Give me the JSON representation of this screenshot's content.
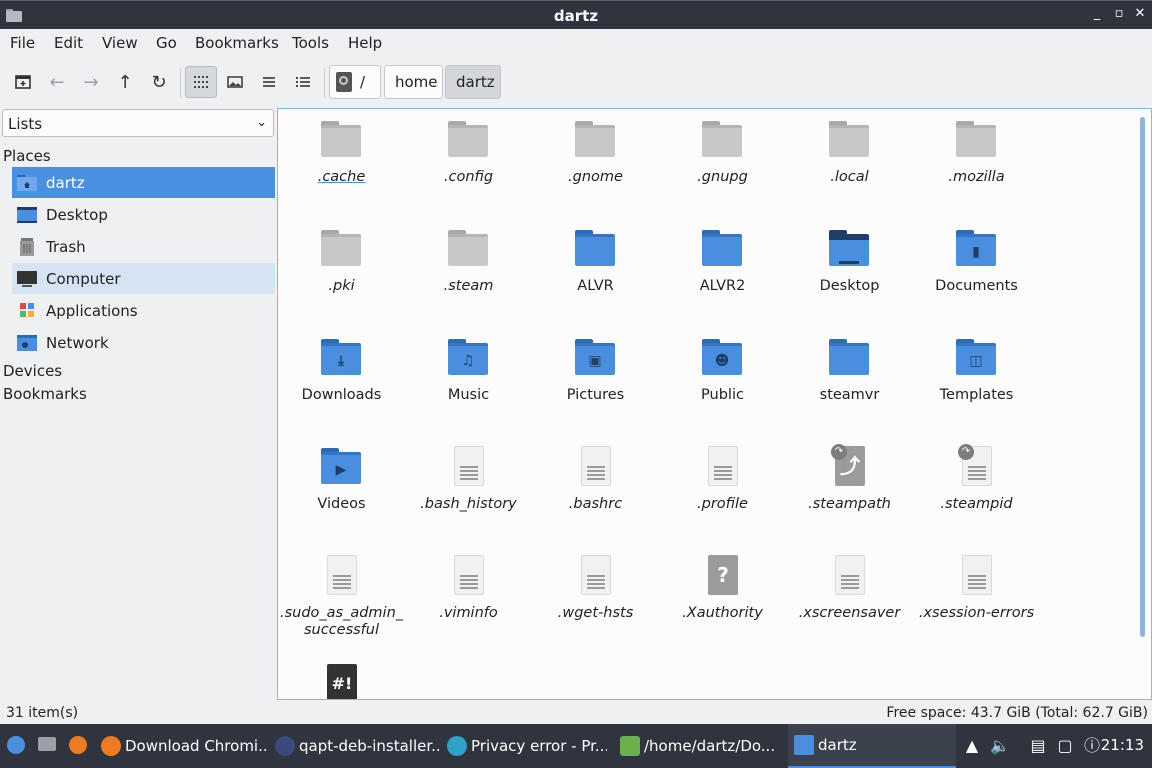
{
  "window": {
    "title": "dartz"
  },
  "menu": [
    "File",
    "Edit",
    "View",
    "Go",
    "Bookmarks",
    "Tools",
    "Help"
  ],
  "toolbar": {
    "breadcrumbs": [
      "/",
      "home",
      "dartz"
    ]
  },
  "sidebar": {
    "combo": "Lists",
    "places_heading": "Places",
    "places": [
      {
        "label": "dartz",
        "icon": "home-folder-icon"
      },
      {
        "label": "Desktop",
        "icon": "desktop-icon"
      },
      {
        "label": "Trash",
        "icon": "trash-icon"
      },
      {
        "label": "Computer",
        "icon": "computer-icon"
      },
      {
        "label": "Applications",
        "icon": "applications-icon"
      },
      {
        "label": "Network",
        "icon": "network-icon"
      }
    ],
    "devices_heading": "Devices",
    "bookmarks_heading": "Bookmarks"
  },
  "files": [
    {
      "name": ".cache",
      "kind": "folder-gray",
      "hidden": true
    },
    {
      "name": ".config",
      "kind": "folder-gray",
      "hidden": true
    },
    {
      "name": ".gnome",
      "kind": "folder-gray",
      "hidden": true
    },
    {
      "name": ".gnupg",
      "kind": "folder-gray",
      "hidden": true
    },
    {
      "name": ".local",
      "kind": "folder-gray",
      "hidden": true
    },
    {
      "name": ".mozilla",
      "kind": "folder-gray",
      "hidden": true
    },
    {
      "name": ".pki",
      "kind": "folder-gray",
      "hidden": true
    },
    {
      "name": ".steam",
      "kind": "folder-gray",
      "hidden": true
    },
    {
      "name": "ALVR",
      "kind": "folder-blue",
      "hidden": false
    },
    {
      "name": "ALVR2",
      "kind": "folder-blue",
      "hidden": false
    },
    {
      "name": "Desktop",
      "kind": "folder-blue",
      "hidden": false
    },
    {
      "name": "Documents",
      "kind": "folder-blue",
      "hidden": false
    },
    {
      "name": "Downloads",
      "kind": "folder-blue",
      "hidden": false
    },
    {
      "name": "Music",
      "kind": "folder-blue",
      "hidden": false
    },
    {
      "name": "Pictures",
      "kind": "folder-blue",
      "hidden": false
    },
    {
      "name": "Public",
      "kind": "folder-blue",
      "hidden": false
    },
    {
      "name": "steamvr",
      "kind": "folder-blue",
      "hidden": false
    },
    {
      "name": "Templates",
      "kind": "folder-blue",
      "hidden": false
    },
    {
      "name": "Videos",
      "kind": "folder-blue",
      "hidden": false
    },
    {
      "name": ".bash_history",
      "kind": "doc",
      "hidden": true
    },
    {
      "name": ".bashrc",
      "kind": "doc",
      "hidden": true
    },
    {
      "name": ".profile",
      "kind": "doc",
      "hidden": true
    },
    {
      "name": ".steampath",
      "kind": "link-unknown",
      "hidden": true
    },
    {
      "name": ".steampid",
      "kind": "link-doc",
      "hidden": true
    },
    {
      "name": ".sudo_as_admin_ successful",
      "kind": "doc",
      "hidden": true
    },
    {
      "name": ".viminfo",
      "kind": "doc",
      "hidden": true
    },
    {
      "name": ".wget-hsts",
      "kind": "doc",
      "hidden": true
    },
    {
      "name": ".Xauthority",
      "kind": "unknown",
      "hidden": true
    },
    {
      "name": ".xscreensaver",
      "kind": "doc",
      "hidden": true
    },
    {
      "name": ".xsession-errors",
      "kind": "doc",
      "hidden": true
    },
    {
      "name": "",
      "kind": "script",
      "hidden": false
    }
  ],
  "status": {
    "count": "31 item(s)",
    "free_space": "Free space: 43.7 GiB (Total: 62.7 GiB)"
  },
  "taskbar": {
    "tasks": [
      "Download Chromi...",
      "qapt-deb-installer...",
      "Privacy error - Pr...",
      "/home/dartz/Do...",
      "dartz"
    ],
    "clock": "21:13"
  }
}
